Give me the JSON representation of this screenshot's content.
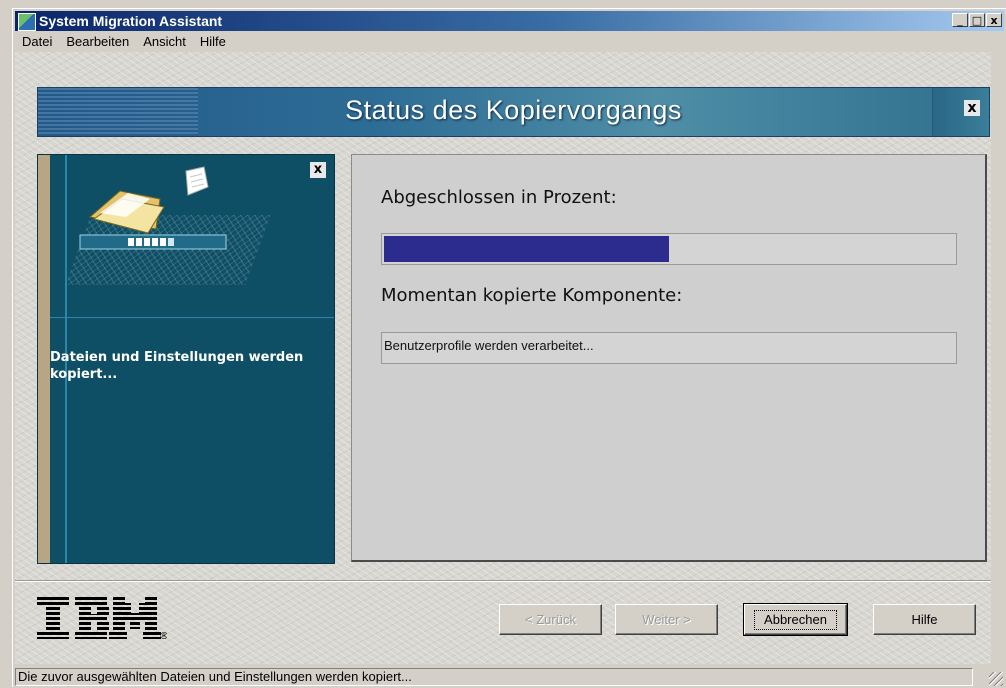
{
  "window": {
    "title": "System Migration Assistant",
    "controls": {
      "minimize": "_",
      "maximize": "□",
      "close": "x"
    }
  },
  "menu": {
    "items": [
      "Datei",
      "Bearbeiten",
      "Ansicht",
      "Hilfe"
    ]
  },
  "banner": {
    "title": "Status des Kopiervorgangs",
    "close": "x"
  },
  "left_panel": {
    "close": "x",
    "caption": "Dateien und Einstellungen werden kopiert...",
    "icons": [
      "folder-icon",
      "document-icon",
      "progress-graphic"
    ]
  },
  "main": {
    "percent_label": "Abgeschlossen in Prozent:",
    "progress_fraction": 0.5,
    "component_label": "Momentan kopierte Komponente:",
    "component_value": "Benutzerprofile werden verarbeitet..."
  },
  "buttons": {
    "back": "< Zurück",
    "next": "Weiter >",
    "cancel": "Abbrechen",
    "help": "Hilfe"
  },
  "logo": {
    "text": "IBM",
    "registered": "®"
  },
  "status_bar": {
    "text": "Die zuvor ausgewählten Dateien und Einstellungen werden kopiert..."
  },
  "colors": {
    "progress_fill": "#2b2c8d",
    "left_panel": "#0e4f66",
    "banner": "#2d6c95"
  }
}
